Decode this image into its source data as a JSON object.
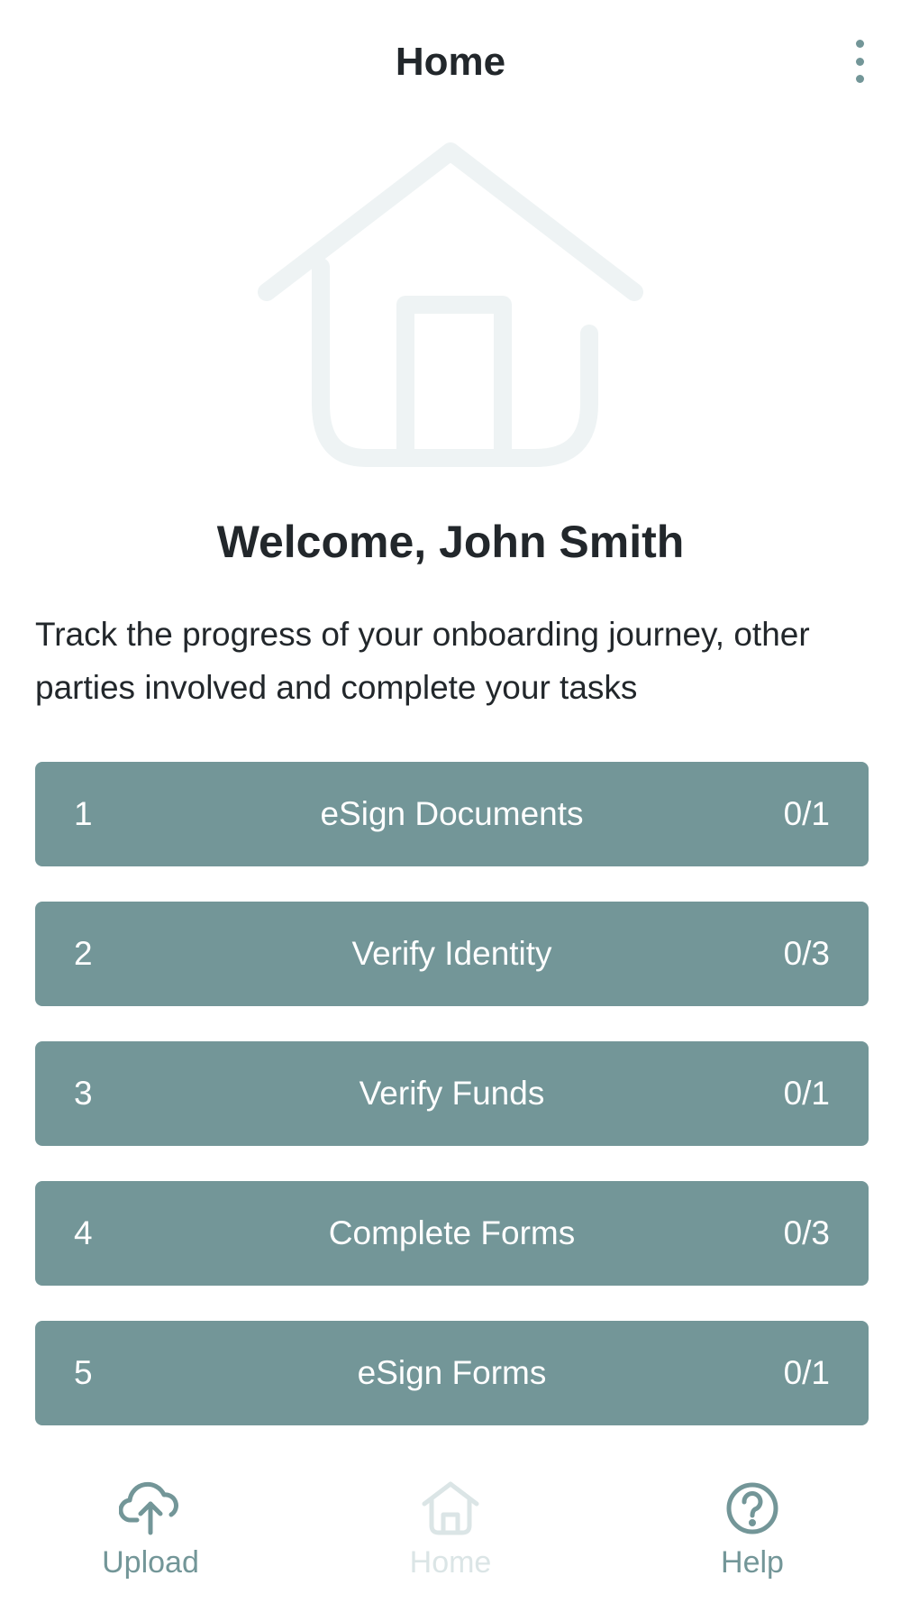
{
  "header": {
    "title": "Home",
    "menu_icon": "more-vertical-icon"
  },
  "hero": {
    "icon": "house-icon",
    "color": "#eef3f4"
  },
  "welcome": {
    "title": "Welcome, John Smith",
    "text": "Track the progress of your onboarding journey, other parties involved and complete your tasks"
  },
  "tasks": [
    {
      "number": "1",
      "label": "eSign Documents",
      "count": "0/1"
    },
    {
      "number": "2",
      "label": "Verify Identity",
      "count": "0/3"
    },
    {
      "number": "3",
      "label": "Verify Funds",
      "count": "0/1"
    },
    {
      "number": "4",
      "label": "Complete Forms",
      "count": "0/3"
    },
    {
      "number": "5",
      "label": "eSign Forms",
      "count": "0/1"
    }
  ],
  "tabbar": {
    "upload": {
      "label": "Upload",
      "icon": "cloud-upload-icon"
    },
    "home": {
      "label": "Home",
      "icon": "home-icon"
    },
    "help": {
      "label": "Help",
      "icon": "help-circle-icon"
    }
  },
  "colors": {
    "accent": "#739698",
    "text": "#22272b",
    "inactive_tab": "#dbe5e6",
    "hero": "#eef3f4"
  }
}
